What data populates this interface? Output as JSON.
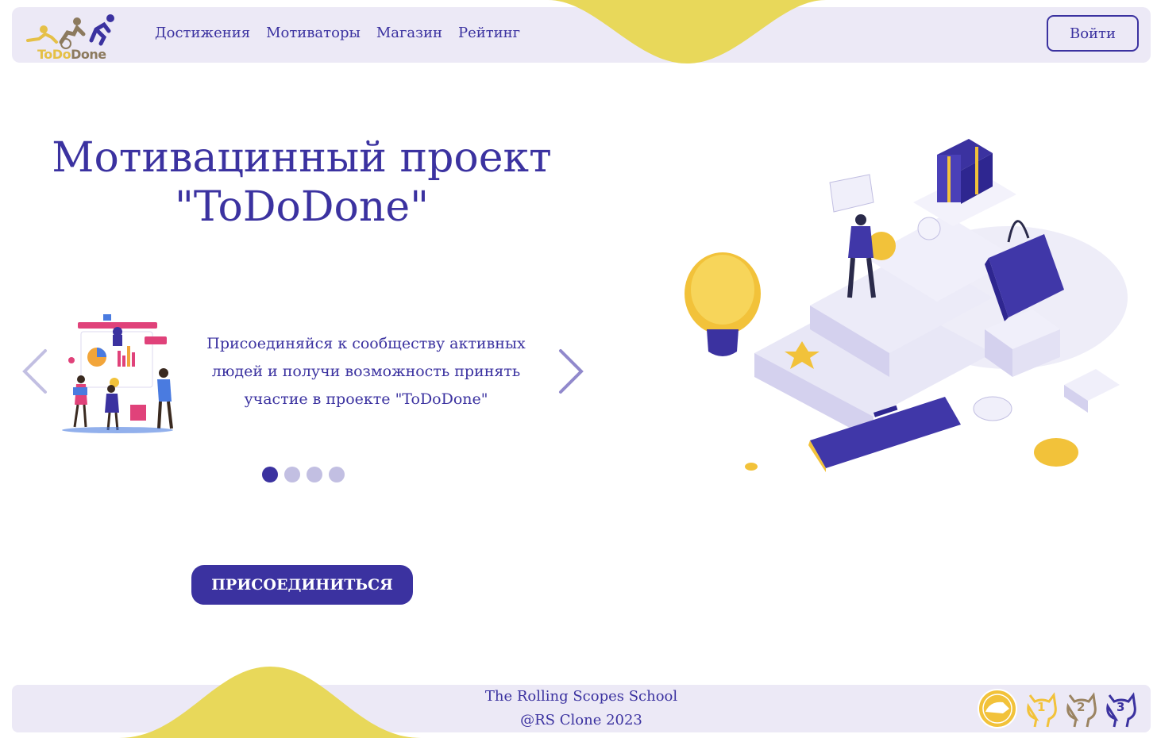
{
  "header": {
    "logo": {
      "text_part1": "ToDo",
      "text_part2": "Done"
    },
    "nav": [
      {
        "label": "Достижения"
      },
      {
        "label": "Мотиваторы"
      },
      {
        "label": "Магазин"
      },
      {
        "label": "Рейтинг"
      }
    ],
    "login_label": "Войти"
  },
  "hero": {
    "title_line1": "Мотивацинный проект",
    "title_line2": "\"ToDoDone\""
  },
  "slider": {
    "text": "Присоединяйся к сообществу активных людей и получи возможность принять участие в проекте \"ToDoDone\"",
    "total_slides": 4,
    "active_index": 0
  },
  "join_label": "ПРИСОЕДИНИТЬСЯ",
  "footer": {
    "line1": "The Rolling Scopes School",
    "line2": "@RS Clone 2023",
    "badges": [
      {
        "icon": "rs-school-logo-icon"
      },
      {
        "icon": "github-cat-icon",
        "label": "1"
      },
      {
        "icon": "github-cat-icon",
        "label": "2"
      },
      {
        "icon": "github-cat-icon",
        "label": "3"
      }
    ]
  },
  "colors": {
    "primary": "#3b32a0",
    "panel": "#ece9f6",
    "accent_yellow": "#e8d85a",
    "dot_inactive": "#c2bfe2"
  }
}
